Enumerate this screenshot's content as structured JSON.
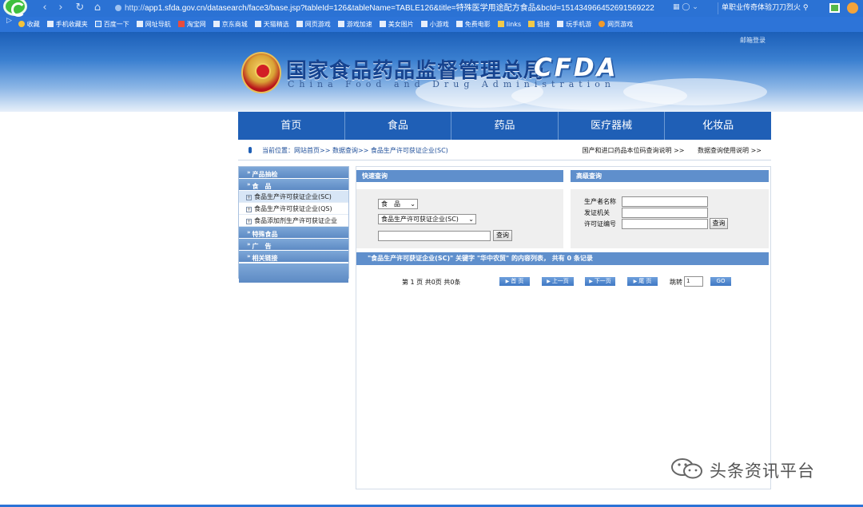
{
  "browser": {
    "url_prefix": "http://",
    "url": "app1.sfda.gov.cn/datasearch/face3/base.jsp?tableId=126&tableName=TABLE126&title=特殊医学用途配方食品&bcId=151434966452691569222",
    "search_text": "单职业传奇体验刀刀烈火",
    "bookmarks": [
      {
        "label": "收藏",
        "icon": "star-icon"
      },
      {
        "label": "手机收藏夹",
        "icon": "mobile-icon"
      },
      {
        "label": "百度一下",
        "icon": "baidu-icon"
      },
      {
        "label": "网址导航",
        "icon": "page-icon"
      },
      {
        "label": "淘宝网",
        "icon": "taobao-icon"
      },
      {
        "label": "京东商城",
        "icon": "page-icon"
      },
      {
        "label": "天猫精选",
        "icon": "page-icon"
      },
      {
        "label": "网页游戏",
        "icon": "page-icon"
      },
      {
        "label": "游戏加速",
        "icon": "page-icon"
      },
      {
        "label": "美女图片",
        "icon": "page-icon"
      },
      {
        "label": "小游戏",
        "icon": "page-icon"
      },
      {
        "label": "免费电影",
        "icon": "page-icon"
      },
      {
        "label": "links",
        "icon": "folder-icon"
      },
      {
        "label": "链接",
        "icon": "folder-icon"
      },
      {
        "label": "玩手机游",
        "icon": "page-icon"
      },
      {
        "label": "网页游戏",
        "icon": "game-icon"
      }
    ]
  },
  "header": {
    "email_login": "邮箱登录",
    "title_cn": "国家食品药品监督管理总局",
    "title_en": "China Food and Drug Administration",
    "logo_text": "CFDA"
  },
  "nav": {
    "items": [
      "首页",
      "食品",
      "药品",
      "医疗器械",
      "化妆品"
    ]
  },
  "breadcrumb": {
    "text": "当前位置：网站首页>> 数据查询>> 食品生产许可获证企业(SC)",
    "right_links": [
      "国产和进口药品本位码查询说明 >>",
      "数据查询使用说明 >>"
    ]
  },
  "sidebar": {
    "heads": [
      "产品抽检",
      "食　品"
    ],
    "sub_items": [
      {
        "label": "食品生产许可获证企业(SC)",
        "active": true
      },
      {
        "label": "食品生产许可获证企业(QS)",
        "active": false
      },
      {
        "label": "食品添加剂生产许可获证企业",
        "active": false
      }
    ],
    "heads_after": [
      "特殊食品",
      "广　告",
      "相关链接"
    ]
  },
  "quick_search": {
    "title": "快速查询",
    "category_value": "食　品",
    "subcategory_value": "食品生产许可获证企业(SC)",
    "keyword_value": "",
    "button": "查询"
  },
  "precise_search": {
    "title": "高级查询",
    "fields": [
      {
        "label": "生产者名称",
        "value": ""
      },
      {
        "label": "发证机关",
        "value": ""
      },
      {
        "label": "许可证编号",
        "value": ""
      }
    ],
    "button": "查询"
  },
  "results": {
    "summary": "\"食品生产许可获证企业(SC)\" 关键字 \"华中农贸\" 的内容列表， 共有 0 条记录",
    "page_info": "第 1 页 共0页 共0条",
    "first": "首 页",
    "prev": "上一页",
    "next": "下一页",
    "last": "尾 页",
    "jump_label": "跳转",
    "jump_value": "1",
    "go": "GO"
  },
  "watermark": {
    "text": "头条资讯平台"
  },
  "colors": {
    "chrome_blue": "#2c73d6",
    "nav_blue": "#1f5fb6",
    "panel_blue": "#5f8fcc",
    "title_blue": "#16438f"
  }
}
